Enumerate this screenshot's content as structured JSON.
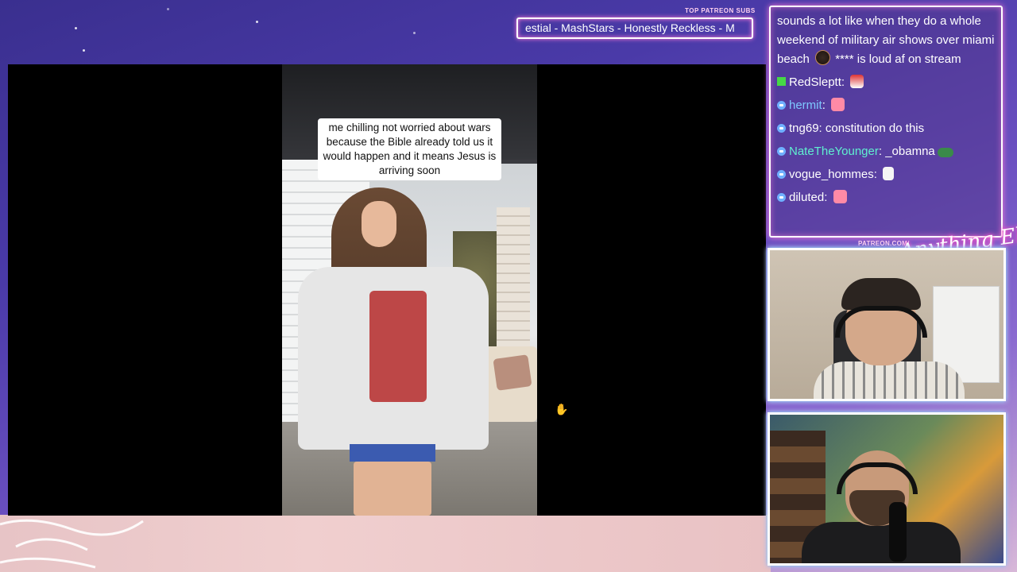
{
  "ticker": {
    "label": "TOP PATREON SUBS",
    "text": "estial - MashStars - Honestly Reckless - M"
  },
  "video": {
    "caption": "me chilling not worried about wars because the Bible already told us it would happen and it means Jesus is arriving soon"
  },
  "chat": {
    "first_message": {
      "text_before": "sounds a lot like when they do a whole weekend of military air shows over miami beach",
      "text_after": "**** is loud af on stream"
    },
    "messages": [
      {
        "user": "RedSleptt",
        "user_color": "#ffffff",
        "badge": "k",
        "text": "",
        "emote": "red"
      },
      {
        "user": "hermit",
        "user_color": "#7ec8ff",
        "badge": "dot",
        "text": "",
        "emote": "pink"
      },
      {
        "user": "tng69",
        "user_color": "#ffffff",
        "badge": "dot",
        "text": "constitution do this",
        "emote": ""
      },
      {
        "user": "NateTheYounger",
        "user_color": "#5ff0d0",
        "badge": "dot",
        "text": "_obamna",
        "emote": "green"
      },
      {
        "user": "vogue_hommes",
        "user_color": "#ffffff",
        "badge": "dot",
        "text": "",
        "emote": "white"
      },
      {
        "user": "diluted",
        "user_color": "#ffffff",
        "badge": "dot",
        "text": "",
        "emote": "pink"
      }
    ]
  },
  "branding": {
    "patreon_url": "PATREON.COM/",
    "logo_text": "Anything Else"
  },
  "colors": {
    "accent_pink": "#ff7ad8",
    "accent_cyan": "#5ff0ff"
  }
}
